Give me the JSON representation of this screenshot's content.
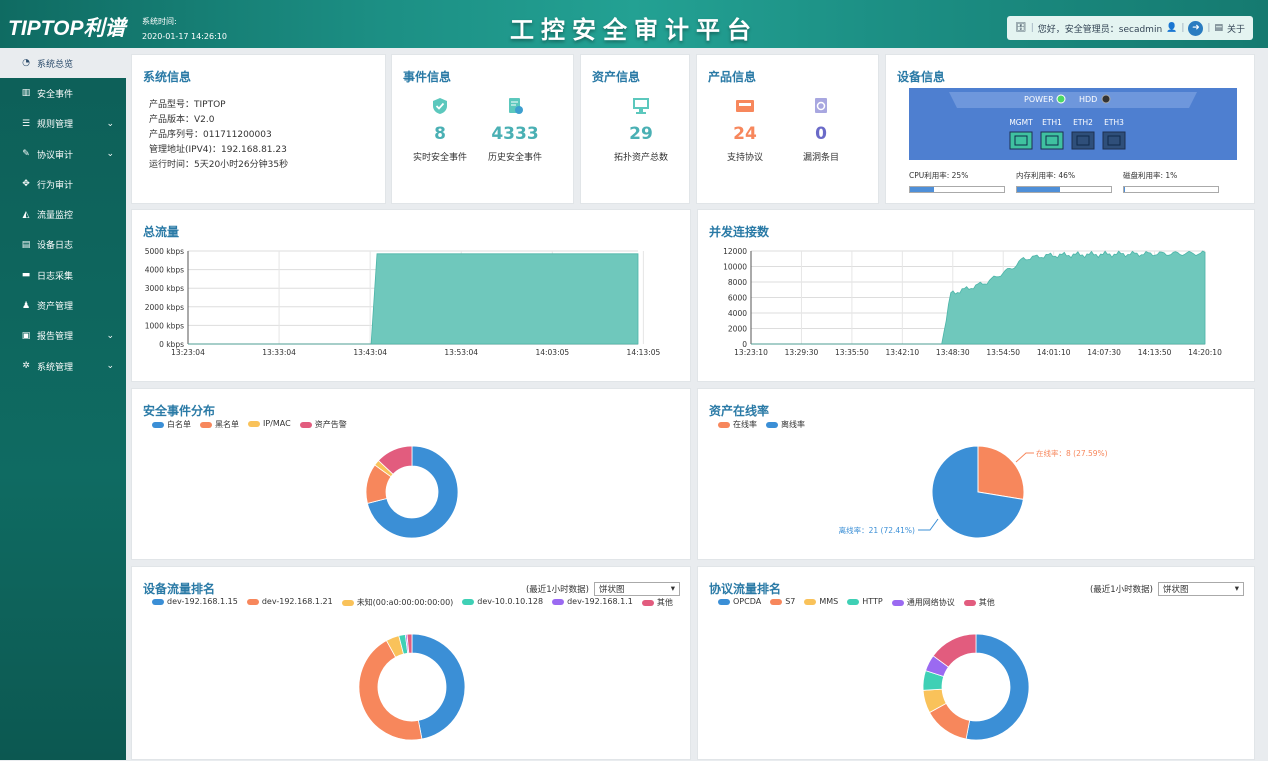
{
  "header": {
    "logo": "TIPTOP利谱",
    "systime_label": "系统时间:",
    "systime_value": "2020-01-17 14:26:10",
    "title": "工控安全审计平台",
    "greeting": "您好，安全管理员：secadmin",
    "about": "关于"
  },
  "sidebar": {
    "items": [
      {
        "label": "系统总览",
        "icon": "dashboard-icon",
        "active": true
      },
      {
        "label": "安全事件",
        "icon": "bar-chart-icon"
      },
      {
        "label": "规则管理",
        "icon": "list-icon",
        "expand": true
      },
      {
        "label": "协议审计",
        "icon": "wrench-icon",
        "expand": true
      },
      {
        "label": "行为审计",
        "icon": "target-icon"
      },
      {
        "label": "流量监控",
        "icon": "area-chart-icon"
      },
      {
        "label": "设备日志",
        "icon": "document-icon"
      },
      {
        "label": "日志采集",
        "icon": "server-icon"
      },
      {
        "label": "资产管理",
        "icon": "sitemap-icon"
      },
      {
        "label": "报告管理",
        "icon": "report-icon",
        "expand": true
      },
      {
        "label": "系统管理",
        "icon": "gears-icon",
        "expand": true
      }
    ]
  },
  "sysinfo": {
    "title": "系统信息",
    "rows": [
      "产品型号：TIPTOP",
      "产品版本：V2.0",
      "产品序列号：011711200003",
      "管理地址(IPV4)：192.168.81.23",
      "运行时间：5天20小时26分钟35秒"
    ]
  },
  "events": {
    "title": "事件信息",
    "realtime": {
      "value": "8",
      "label": "实时安全事件"
    },
    "history": {
      "value": "4333",
      "label": "历史安全事件"
    }
  },
  "assets": {
    "title": "资产信息",
    "total": {
      "value": "29",
      "label": "拓扑资产总数"
    }
  },
  "product": {
    "title": "产品信息",
    "protocols": {
      "value": "24",
      "label": "支持协议"
    },
    "vulns": {
      "value": "0",
      "label": "漏洞条目"
    }
  },
  "device": {
    "title": "设备信息",
    "power": "POWER",
    "hdd": "HDD",
    "ports": [
      "MGMT",
      "ETH1",
      "ETH2",
      "ETH3"
    ],
    "port_active": [
      true,
      true,
      false,
      false
    ],
    "cpu_label": "CPU利用率: 25%",
    "cpu": 0.25,
    "mem_label": "内存利用率: 46%",
    "mem": 0.46,
    "disk_label": "磁盘利用率: 1%",
    "disk": 0.01,
    "colors": {
      "panel": "#4e7fd0",
      "port_on": "#3fc1a0",
      "port_off": "#2f4f7a"
    }
  },
  "traffic": {
    "title": "总流量",
    "chart_data": {
      "type": "area",
      "color": "#6fc8bc",
      "y_ticks": [
        "5000 kbps",
        "4000 kbps",
        "3000 kbps",
        "2000 kbps",
        "1000 kbps",
        "0 kbps"
      ],
      "ylim": [
        0,
        5000
      ],
      "x_ticks": [
        "13:23:04",
        "13:33:04",
        "13:43:04",
        "13:53:04",
        "14:03:05",
        "14:13:05"
      ],
      "x": [
        0,
        0.407,
        0.42,
        1.0
      ],
      "y": [
        0,
        0,
        4850,
        4850
      ]
    }
  },
  "conn": {
    "title": "并发连接数",
    "chart_data": {
      "type": "area",
      "color": "#6fc8bc",
      "y_ticks": [
        "12000",
        "10000",
        "8000",
        "6000",
        "4000",
        "2000",
        "0"
      ],
      "ylim": [
        0,
        12000
      ],
      "x_ticks": [
        "13:23:10",
        "13:29:30",
        "13:35:50",
        "13:42:10",
        "13:48:30",
        "13:54:50",
        "14:01:10",
        "14:07:30",
        "14:13:50",
        "14:20:10"
      ],
      "x": [
        0,
        0.42,
        0.44,
        0.48,
        0.52,
        0.55,
        0.58,
        0.6,
        0.65,
        0.7,
        0.8,
        1.0
      ],
      "y": [
        0,
        0,
        6500,
        7200,
        8000,
        9000,
        10000,
        11000,
        11400,
        11500,
        11600,
        11700
      ]
    }
  },
  "secdist": {
    "title": "安全事件分布",
    "legend": [
      {
        "name": "白名单",
        "color": "#3b8fd6"
      },
      {
        "name": "黑名单",
        "color": "#f7875c"
      },
      {
        "name": "IP/MAC",
        "color": "#f9c25a"
      },
      {
        "name": "资产告警",
        "color": "#e25c7e"
      }
    ],
    "chart_data": {
      "type": "pie",
      "values": [
        71,
        14,
        2,
        13
      ]
    }
  },
  "online": {
    "title": "资产在线率",
    "legend": [
      {
        "name": "在线率",
        "color": "#f7875c"
      },
      {
        "name": "离线率",
        "color": "#3b8fd6"
      }
    ],
    "on_label": "在线率：8 (27.59%)",
    "off_label": "离线率：21 (72.41%)",
    "chart_data": {
      "type": "pie",
      "values": [
        8,
        21
      ]
    }
  },
  "devtraffic": {
    "title": "设备流量排名",
    "range": "(最近1小时数据)",
    "select": "饼状图",
    "legend": [
      {
        "name": "dev-192.168.1.15",
        "color": "#3b8fd6"
      },
      {
        "name": "dev-192.168.1.21",
        "color": "#f7875c"
      },
      {
        "name": "未知(00:a0:00:00:00:00)",
        "color": "#f9c25a"
      },
      {
        "name": "dev-10.0.10.128",
        "color": "#3fd0b5"
      },
      {
        "name": "dev-192.168.1.1",
        "color": "#9b6af1"
      },
      {
        "name": "其他",
        "color": "#e25c7e"
      }
    ],
    "chart_data": {
      "type": "pie",
      "values": [
        47,
        45,
        4,
        2,
        0.5,
        1.5
      ]
    }
  },
  "prototraffic": {
    "title": "协议流量排名",
    "range": "(最近1小时数据)",
    "select": "饼状图",
    "legend": [
      {
        "name": "OPCDA",
        "color": "#3b8fd6"
      },
      {
        "name": "S7",
        "color": "#f7875c"
      },
      {
        "name": "MMS",
        "color": "#f9c25a"
      },
      {
        "name": "HTTP",
        "color": "#3fd0b5"
      },
      {
        "name": "通用网络协议",
        "color": "#9b6af1"
      },
      {
        "name": "其他",
        "color": "#e25c7e"
      }
    ],
    "chart_data": {
      "type": "pie",
      "values": [
        53,
        14,
        7,
        6,
        5,
        15
      ]
    }
  }
}
